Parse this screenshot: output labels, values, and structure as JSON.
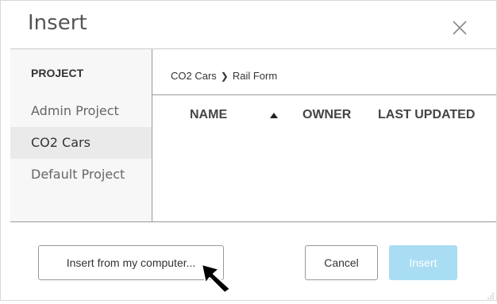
{
  "dialog": {
    "title": "Insert",
    "close_icon": "close-icon"
  },
  "sidebar": {
    "heading": "PROJECT",
    "items": [
      {
        "label": "Admin Project",
        "selected": false
      },
      {
        "label": "CO2 Cars",
        "selected": true
      },
      {
        "label": "Default Project",
        "selected": false
      }
    ]
  },
  "main": {
    "breadcrumb": [
      "CO2 Cars",
      "Rail Form"
    ],
    "breadcrumb_separator": "❯",
    "columns": {
      "name": "NAME",
      "owner": "OWNER",
      "last_updated": "LAST UPDATED"
    },
    "sort_icon": "sort-ascending-icon",
    "rows": []
  },
  "footer": {
    "insert_from_computer_label": "Insert from my computer...",
    "cancel_label": "Cancel",
    "insert_label": "Insert"
  },
  "colors": {
    "primary_button": "#a9ddf3",
    "selected_item": "#eaeaea",
    "sidebar_bg": "#f7f7f7"
  }
}
